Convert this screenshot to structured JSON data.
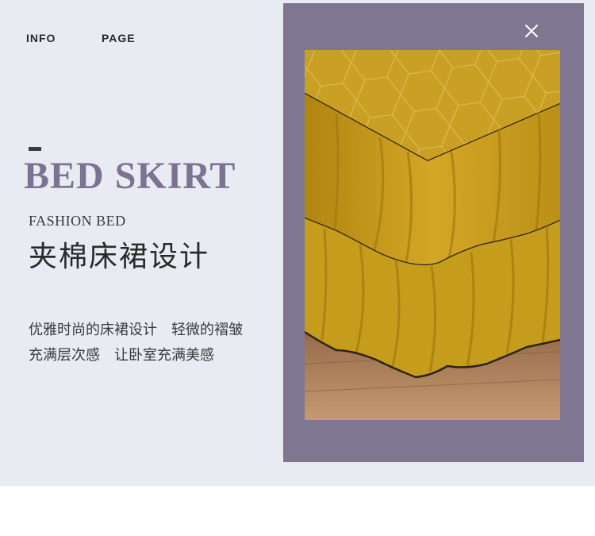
{
  "nav": {
    "info": "INFO",
    "page": "PAGE"
  },
  "hero": {
    "title": "BED SKIRT",
    "subtitle": "FASHION BED",
    "heading_cn": "夹棉床裙设计",
    "desc_line1": "优雅时尚的床裙设计　轻微的褶皱",
    "desc_line2": "充满层次感　让卧室充满美感"
  },
  "colors": {
    "background": "#e9ebf3",
    "frame": "#7f7791",
    "title_accent": "#7b7391",
    "fabric": "#c49a1c",
    "piping": "#2b2418",
    "floor": "#a8794d"
  },
  "icons": {
    "close": "close-icon"
  }
}
